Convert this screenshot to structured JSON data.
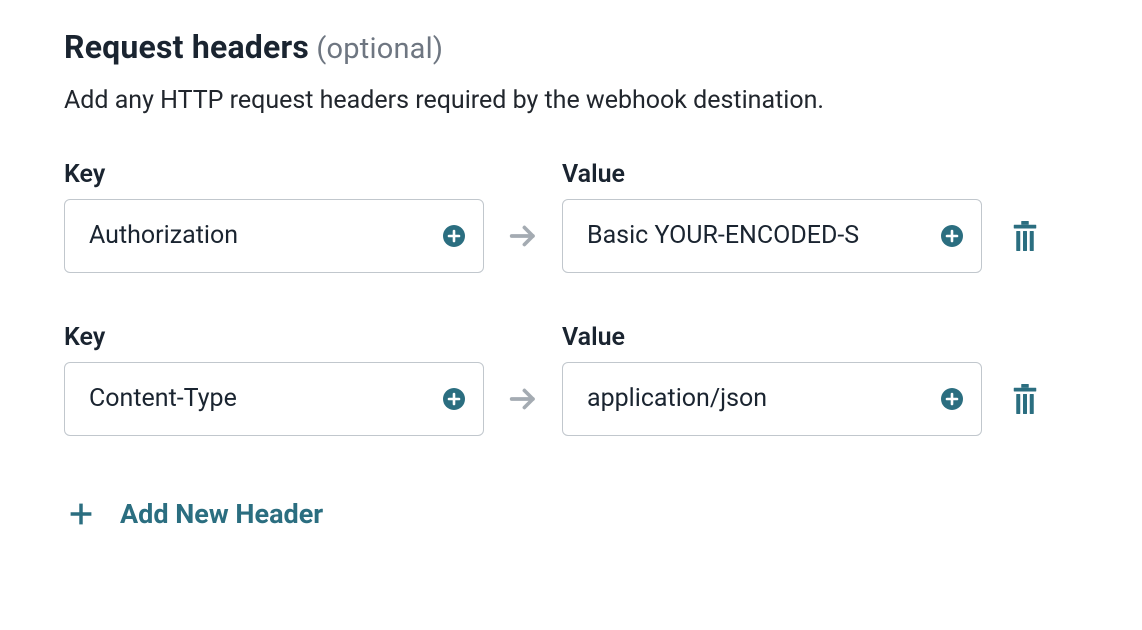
{
  "section": {
    "title": "Request headers",
    "optional_suffix": " (optional)",
    "description": "Add any HTTP request headers required by the webhook destination."
  },
  "labels": {
    "key": "Key",
    "value": "Value",
    "add_new_header": "Add New Header"
  },
  "headers": [
    {
      "key": "Authorization",
      "value": "Basic YOUR-ENCODED-S"
    },
    {
      "key": "Content-Type",
      "value": "application/json"
    }
  ],
  "colors": {
    "accent": "#2b6e80",
    "arrow": "#9aa0a6",
    "text": "#1a2430"
  }
}
